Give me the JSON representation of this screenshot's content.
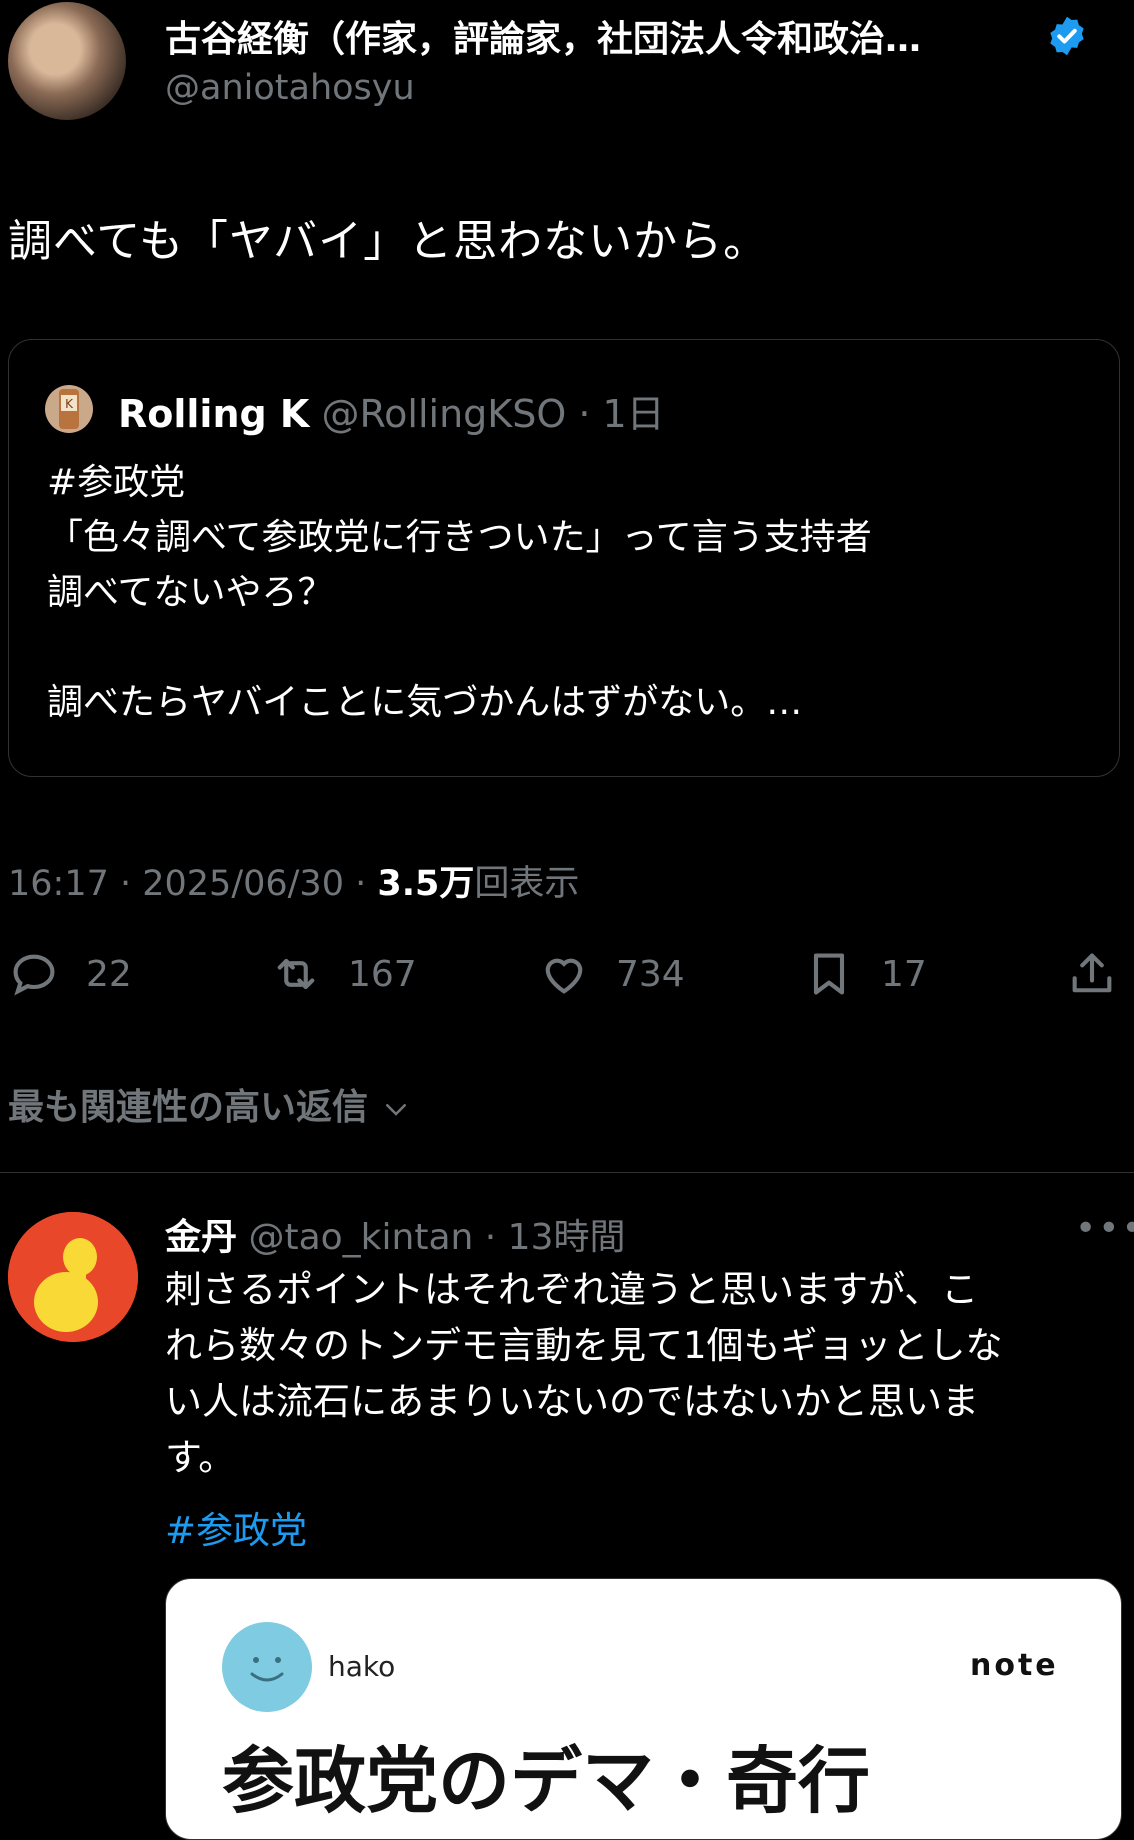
{
  "author": {
    "name": "古谷経衡（作家，評論家，社団法人令和政治…",
    "handle": "@aniotahosyu"
  },
  "tweet": {
    "text": "調べても「ヤバイ」と思わないから。"
  },
  "quote": {
    "name": "Rolling K",
    "handle": "@RollingKSO",
    "time": "· 1日",
    "body": "#参政党\n「色々調べて参政党に行きついた」って言う支持者\n調べてないやろ？\n\n調べたらヤバイことに気づかんはずがない。…"
  },
  "meta": {
    "time": "16:17 · 2025/06/30 ·",
    "views": "3.5万",
    "views_suffix": "回表示"
  },
  "actions": {
    "replies": "22",
    "retweets": "167",
    "likes": "734",
    "bookmarks": "17"
  },
  "relevant_label": "最も関連性の高い返信",
  "reply": {
    "name": "金丹",
    "handle": "@tao_kintan",
    "time": "· 13時間",
    "more": "•••",
    "body": "刺さるポイントはそれぞれ違うと思いますが、こ\nれら数々のトンデモ言動を見て1個もギョッとしな\nい人は流石にあまりいないのではないかと思いま\nす。",
    "hashtag": "#参政党"
  },
  "link_card": {
    "author": "hako",
    "site": "note",
    "title": "参政党のデマ・奇行"
  },
  "colors": {
    "background": "#000000",
    "muted": "#71767b",
    "link": "#1d9bf0",
    "verified": "#1d9bf0"
  },
  "icons": [
    "verified-badge-icon",
    "reply-icon",
    "retweet-icon",
    "like-icon",
    "bookmark-icon",
    "share-icon",
    "chevron-down-icon",
    "more-icon"
  ]
}
